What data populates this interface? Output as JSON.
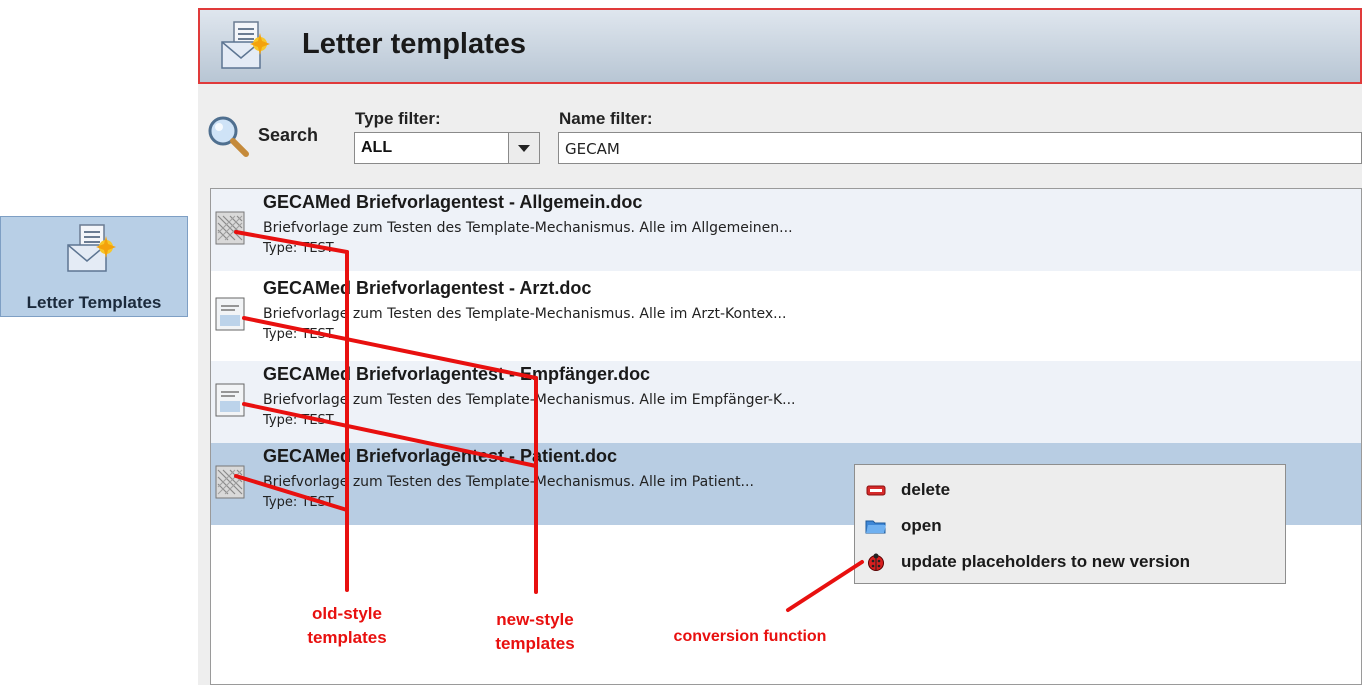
{
  "launcher": {
    "label": "Letter Templates",
    "icon": "letter-template-icon"
  },
  "header": {
    "title": "Letter templates",
    "icon": "letter-template-icon"
  },
  "toolbar": {
    "search_label": "Search",
    "type_filter_label": "Type filter:",
    "type_filter_value": "ALL",
    "name_filter_label": "Name filter:",
    "name_filter_value": "GECAM"
  },
  "templates": [
    {
      "name": "GECAMed Briefvorlagentest - Allgemein.doc",
      "description": "Briefvorlage zum Testen des Template-Mechanismus. Alle im Allgemeinen...",
      "type": "Type: TEST",
      "style": "old"
    },
    {
      "name": "GECAMed Briefvorlagentest - Arzt.doc",
      "description": "Briefvorlage zum Testen des Template-Mechanismus. Alle im Arzt-Kontex...",
      "type": "Type: TEST",
      "style": "new"
    },
    {
      "name": "GECAMed Briefvorlagentest - Empfänger.doc",
      "description": "Briefvorlage zum Testen des Template-Mechanismus. Alle im Empfänger-K...",
      "type": "Type: TEST",
      "style": "new"
    },
    {
      "name": "GECAMed Briefvorlagentest - Patient.doc",
      "description": "Briefvorlage zum Testen des Template-Mechanismus. Alle im Patient...",
      "type": "Type: TEST",
      "style": "old",
      "selected": true
    }
  ],
  "context_menu": {
    "delete": "delete",
    "open": "open",
    "update": "update placeholders to new version"
  },
  "annotations": {
    "old_style_line1": "old-style",
    "old_style_line2": "templates",
    "new_style_line1": "new-style",
    "new_style_line2": "templates",
    "conversion": "conversion function"
  },
  "colors": {
    "annotation_red": "#e8100f",
    "row_alt": "#eef2f8",
    "row_selected": "#b8cde3",
    "header_border": "#e03a3a"
  }
}
